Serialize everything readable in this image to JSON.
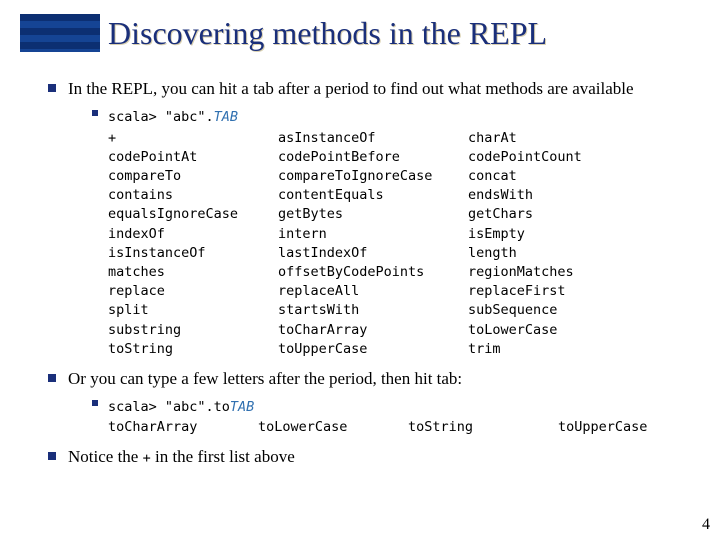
{
  "title": "Discovering methods in the REPL",
  "bullets": {
    "b1": "In the REPL, you can hit a tab after a period to find out what methods are available",
    "b2": "Or you can type a few letters after the period, then hit tab:",
    "b3_prefix": "Notice the ",
    "b3_code": "+",
    "b3_suffix": " in the first list above"
  },
  "repl1": {
    "prompt": "scala> \"abc\".",
    "tab": "TAB",
    "rows": [
      [
        "+",
        "asInstanceOf",
        "charAt"
      ],
      [
        "codePointAt",
        "codePointBefore",
        "codePointCount"
      ],
      [
        "compareTo",
        "compareToIgnoreCase",
        "concat"
      ],
      [
        "contains",
        "contentEquals",
        "endsWith"
      ],
      [
        "equalsIgnoreCase",
        "getBytes",
        "getChars"
      ],
      [
        "indexOf",
        "intern",
        "isEmpty"
      ],
      [
        "isInstanceOf",
        "lastIndexOf",
        "length"
      ],
      [
        "matches",
        "offsetByCodePoints",
        "regionMatches"
      ],
      [
        "replace",
        "replaceAll",
        "replaceFirst"
      ],
      [
        "split",
        "startsWith",
        "subSequence"
      ],
      [
        "substring",
        "toCharArray",
        "toLowerCase"
      ],
      [
        "toString",
        "toUpperCase",
        "trim"
      ]
    ]
  },
  "repl2": {
    "prompt": "scala> \"abc\".to",
    "tab": "TAB",
    "cols": [
      "toCharArray",
      "toLowerCase",
      "toString",
      "toUpperCase"
    ]
  },
  "pagenum": "4"
}
